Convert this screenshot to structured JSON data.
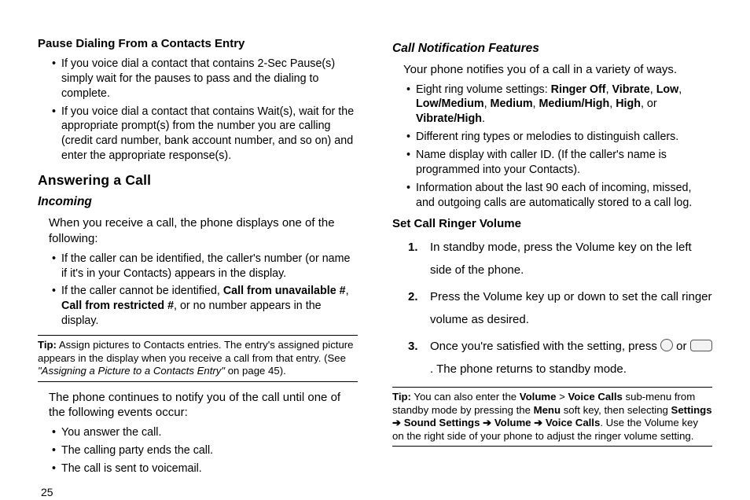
{
  "pageNumber": "25",
  "left": {
    "pauseHeading": "Pause Dialing From a Contacts Entry",
    "pauseBullets": [
      "If you voice dial a contact that contains 2-Sec Pause(s) simply wait for the pauses to pass and the dialing to complete.",
      "If you voice dial a contact that contains Wait(s), wait for the appropriate prompt(s) from the number you are calling (credit card number, bank account number, and so on) and enter the appropriate response(s)."
    ],
    "answerHeading": "Answering a Call",
    "incomingHeading": "Incoming",
    "incomingIntro": "When you receive a call, the phone displays one of the following:",
    "incomingBullets": {
      "b1": "If the caller can be identified, the caller's number (or name if it's in your Contacts) appears in the display.",
      "b2_pre": "If the caller cannot be identified, ",
      "b2_bold1": "Call from unavailable #",
      "b2_sep": ", ",
      "b2_bold2": "Call from restricted #",
      "b2_post": ", or no number appears in the display."
    },
    "tip": {
      "label": "Tip:",
      "body_pre": " Assign pictures to Contacts entries. The entry's assigned picture appears in the display when you receive a call from that entry. (See ",
      "ref": "\"Assigning a Picture to a Contacts Entry\"",
      "body_post": " on page 45)."
    },
    "continueIntro": "The phone continues to notify you of the call until one of the following events occur:",
    "continueBullets": [
      "You answer the call.",
      "The calling party ends the call.",
      "The call is sent to voicemail."
    ]
  },
  "right": {
    "notifHeading": "Call Notification Features",
    "notifIntro": "Your phone notifies you of a call in a variety of ways.",
    "ringLine": {
      "pre": "Eight ring volume settings: ",
      "opts": [
        "Ringer Off",
        "Vibrate",
        "Low",
        "Low/Medium",
        "Medium",
        "Medium/High",
        "High"
      ],
      "or": ", or ",
      "last": "Vibrate/High",
      "end": "."
    },
    "notifBullets": [
      "Different ring types or melodies to distinguish callers.",
      "Name display with caller ID. (If the caller's name is programmed into your Contacts).",
      "Information about the last 90 each of incoming, missed, and outgoing calls are automatically stored to a call log."
    ],
    "setRingerHeading": "Set Call Ringer Volume",
    "steps": {
      "s1": "In standby mode, press the Volume key on the left side of the phone.",
      "s2": "Press the Volume key up or down to set the call ringer volume as desired.",
      "s3_pre": "Once you're satisfied with the setting, press ",
      "s3_or": " or ",
      "s3_post": ". ",
      "s3_tail": "The phone returns to standby mode."
    },
    "tip": {
      "label": "Tip:",
      "pre": " You can also enter the ",
      "volume": "Volume",
      "gt": " > ",
      "voiceCalls": "Voice Calls",
      "mid": " sub-menu from standby mode by pressing the ",
      "menu": "Menu",
      "mid2": " soft key, then selecting ",
      "settings": "Settings",
      "sound": "Sound Settings",
      "vol2": "Volume",
      "vc2": "Voice Calls",
      "post": ". Use the Volume key on the right side of your phone to adjust the ringer volume setting."
    }
  }
}
